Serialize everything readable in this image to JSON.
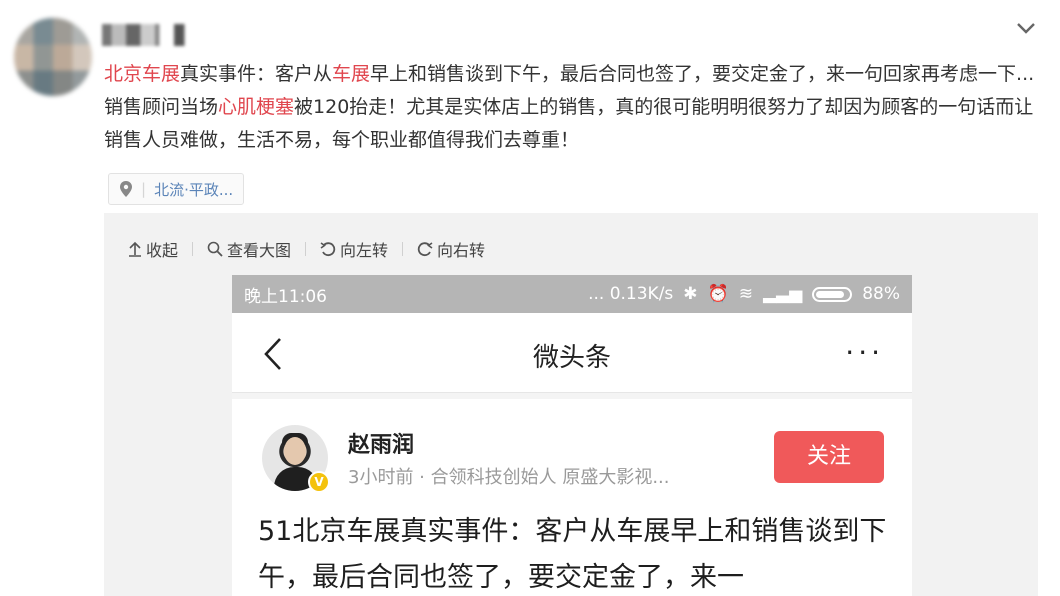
{
  "post": {
    "username": "ning",
    "segments": [
      {
        "text": "北京车展",
        "hl": true
      },
      {
        "text": "真实事件：客户从",
        "hl": false
      },
      {
        "text": "车展",
        "hl": true
      },
      {
        "text": "早上和销售谈到下午，最后合同也签了，要交定金了，来一句回家再考虑一下...销售顾问当场",
        "hl": false
      },
      {
        "text": "心肌梗塞",
        "hl": true
      },
      {
        "text": "被120抬走！尤其是实体店上的销售，真的很可能明明很努力了却因为顾客的一句话而让销售人员难做，生活不易，每个职业都值得我们去尊重！",
        "hl": false
      }
    ],
    "location": "北流·平政..."
  },
  "toolbar": {
    "collapse": "收起",
    "view_large": "查看大图",
    "rotate_left": "向左转",
    "rotate_right": "向右转"
  },
  "phone": {
    "time": "晚上11:06",
    "status": "... 0.13K/s",
    "battery": "88%",
    "nav_title": "微头条",
    "nav_more": "···"
  },
  "card": {
    "author": "赵雨润",
    "meta": "3小时前 · 合领科技创始人 原盛大影视...",
    "follow": "关注",
    "badge": "V",
    "headline": "51北京车展真实事件：客户从车展早上和销售谈到下午，最后合同也签了，要交定金了，来一"
  },
  "colors": {
    "highlight": "#e0464e",
    "link": "#5b84b8",
    "follow": "#f0595a"
  }
}
